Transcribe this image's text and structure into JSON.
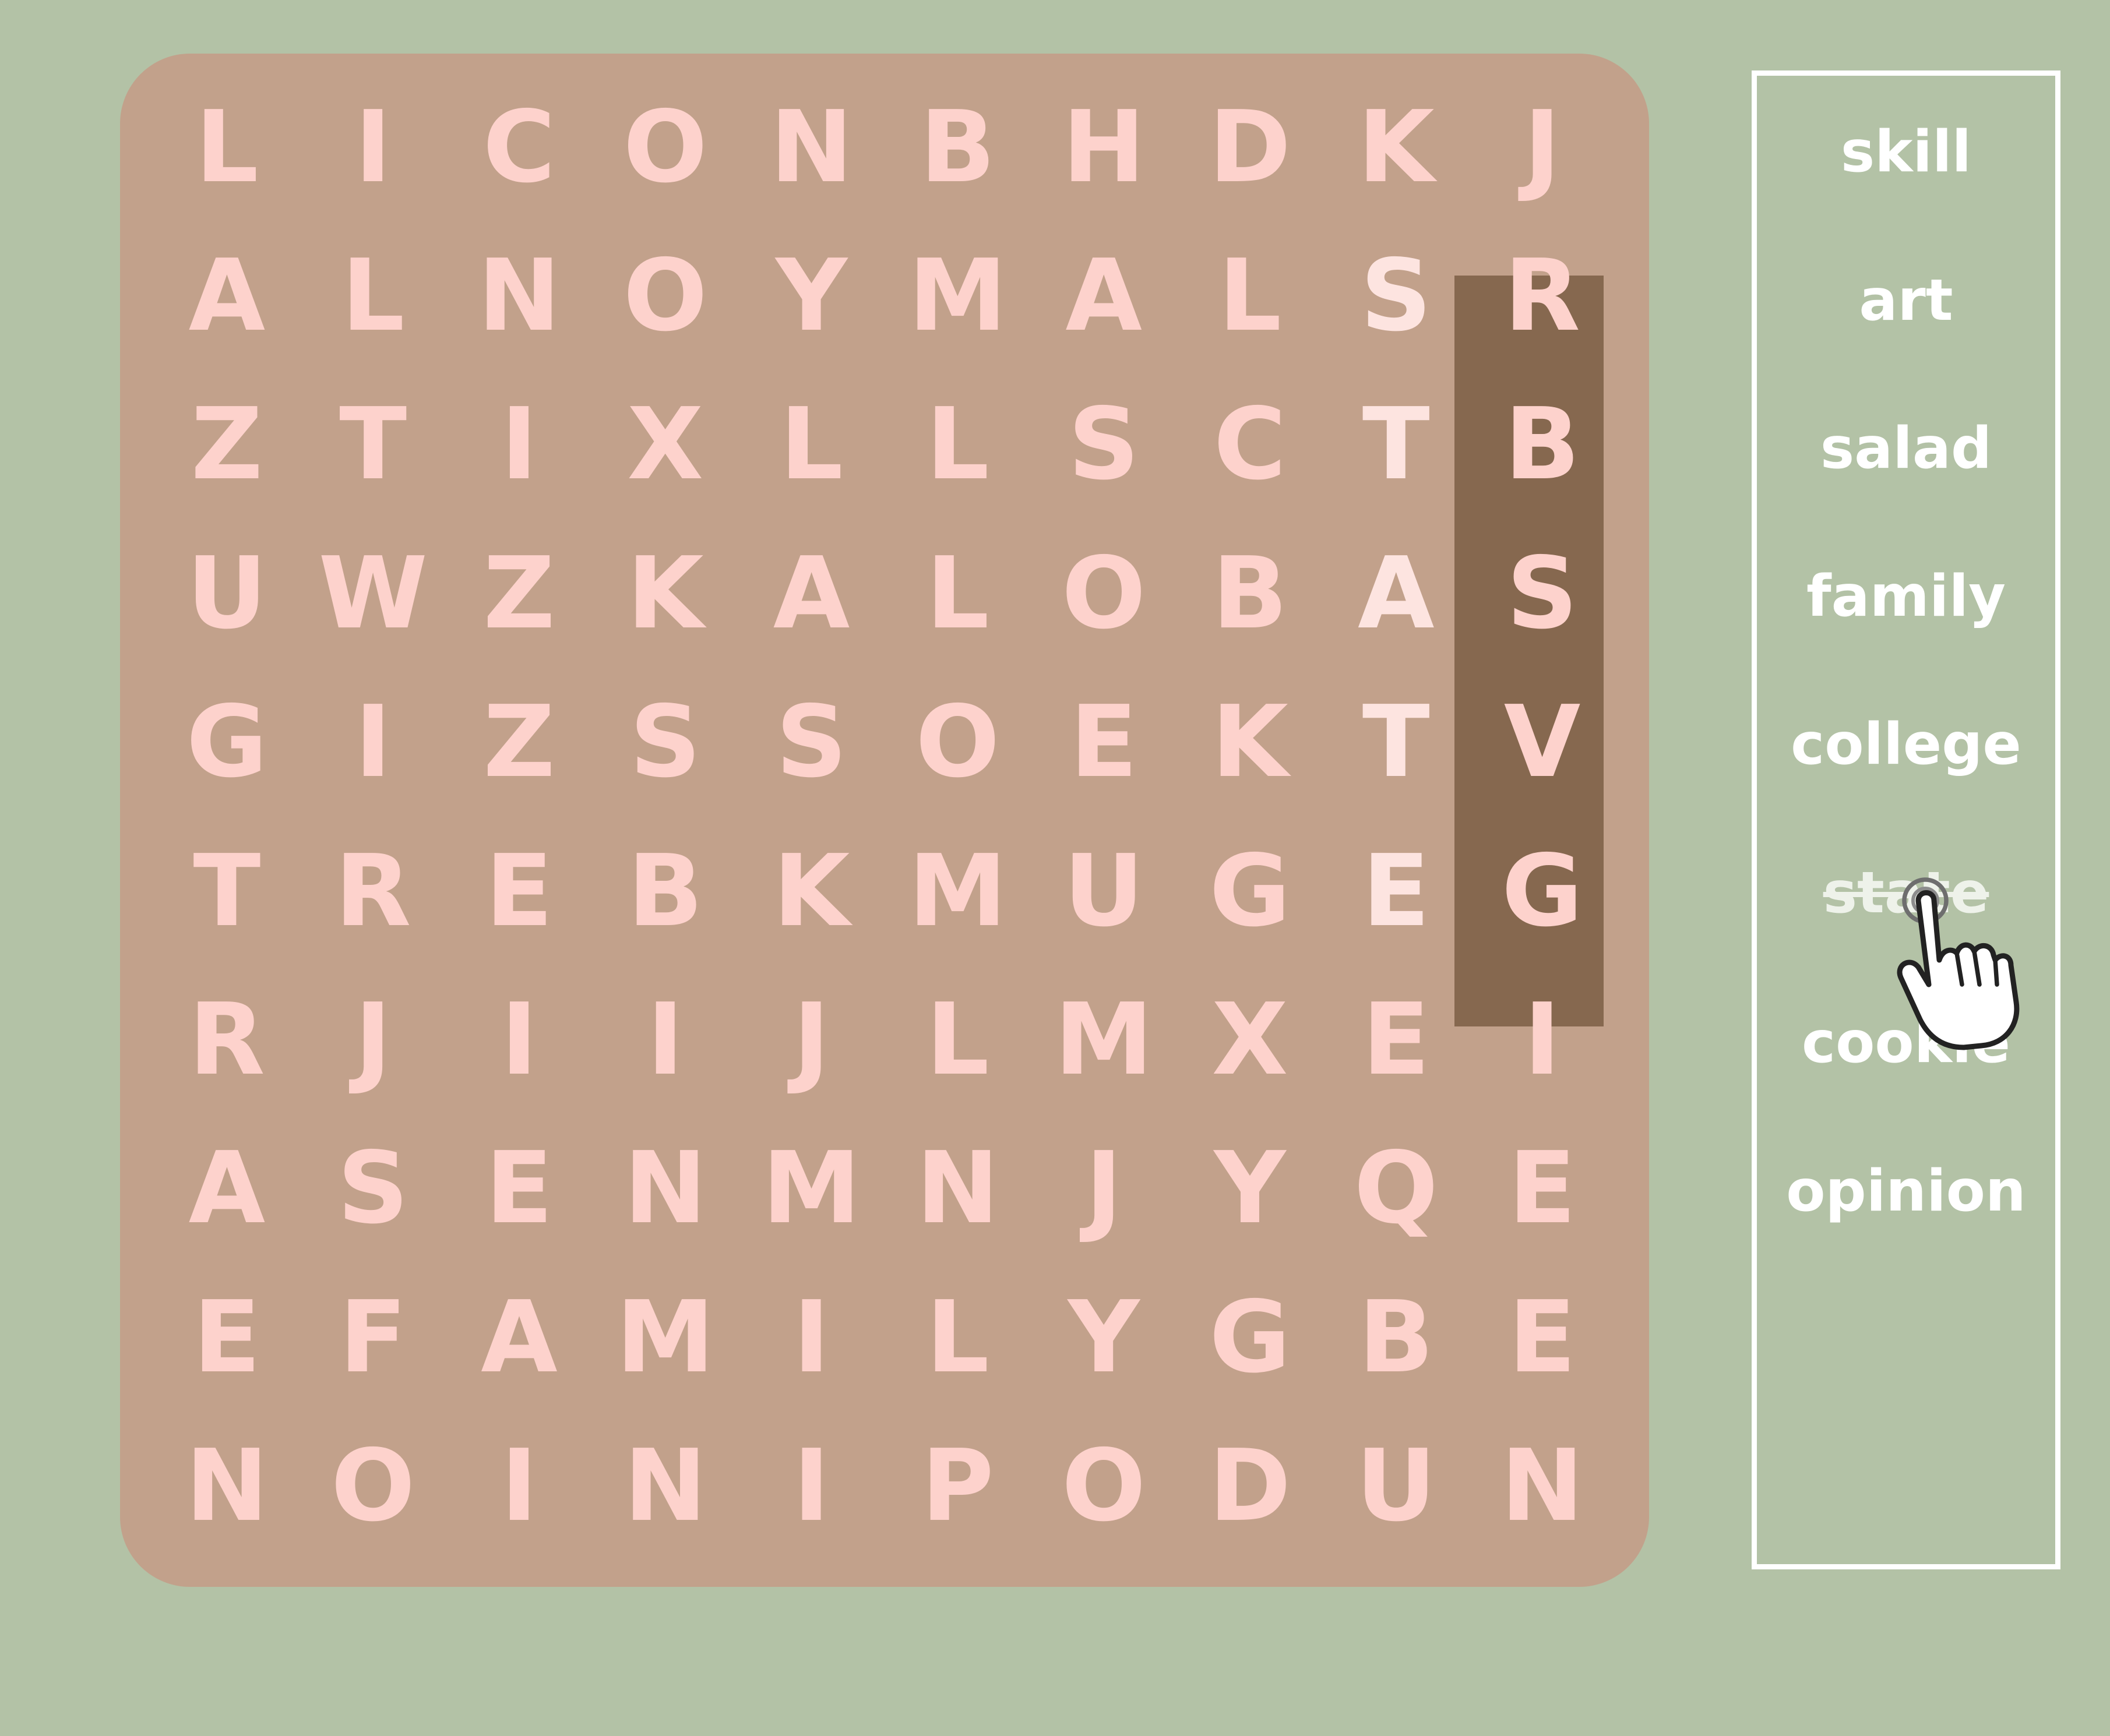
{
  "grid": {
    "rows": [
      [
        "L",
        "I",
        "C",
        "O",
        "N",
        "B",
        "H",
        "D",
        "K",
        "J"
      ],
      [
        "A",
        "L",
        "N",
        "O",
        "Y",
        "M",
        "A",
        "L",
        "S",
        "R"
      ],
      [
        "Z",
        "T",
        "I",
        "X",
        "L",
        "L",
        "S",
        "C",
        "T",
        "B"
      ],
      [
        "U",
        "W",
        "Z",
        "K",
        "A",
        "L",
        "O",
        "B",
        "A",
        "S"
      ],
      [
        "G",
        "I",
        "Z",
        "S",
        "S",
        "O",
        "E",
        "K",
        "T",
        "V"
      ],
      [
        "T",
        "R",
        "E",
        "B",
        "K",
        "M",
        "U",
        "G",
        "E",
        "G"
      ],
      [
        "R",
        "J",
        "I",
        "I",
        "J",
        "L",
        "M",
        "X",
        "E",
        "I"
      ],
      [
        "A",
        "S",
        "E",
        "N",
        "M",
        "N",
        "J",
        "Y",
        "Q",
        "E"
      ],
      [
        "E",
        "F",
        "A",
        "M",
        "I",
        "L",
        "Y",
        "G",
        "B",
        "E"
      ],
      [
        "N",
        "O",
        "I",
        "N",
        "I",
        "P",
        "O",
        "D",
        "U",
        "N"
      ]
    ],
    "found": {
      "word": "state",
      "column": 8,
      "rows": [
        1,
        2,
        3,
        4,
        5
      ]
    }
  },
  "word_list": {
    "words": [
      {
        "text": "skill",
        "found": false
      },
      {
        "text": "art",
        "found": false
      },
      {
        "text": "salad",
        "found": false
      },
      {
        "text": "family",
        "found": false
      },
      {
        "text": "college",
        "found": false
      },
      {
        "text": "state",
        "found": true
      },
      {
        "text": "cookie",
        "found": false
      },
      {
        "text": "opinion",
        "found": false
      }
    ]
  },
  "colors": {
    "background": "#b3c2a6",
    "board": "#c2a18b",
    "highlight": "#86684f",
    "letter": "#fdd2cc",
    "word_text": "#ffffff",
    "word_list_border": "#ffffff"
  },
  "cursor": {
    "icon": "pointing-hand-cursor-icon"
  }
}
